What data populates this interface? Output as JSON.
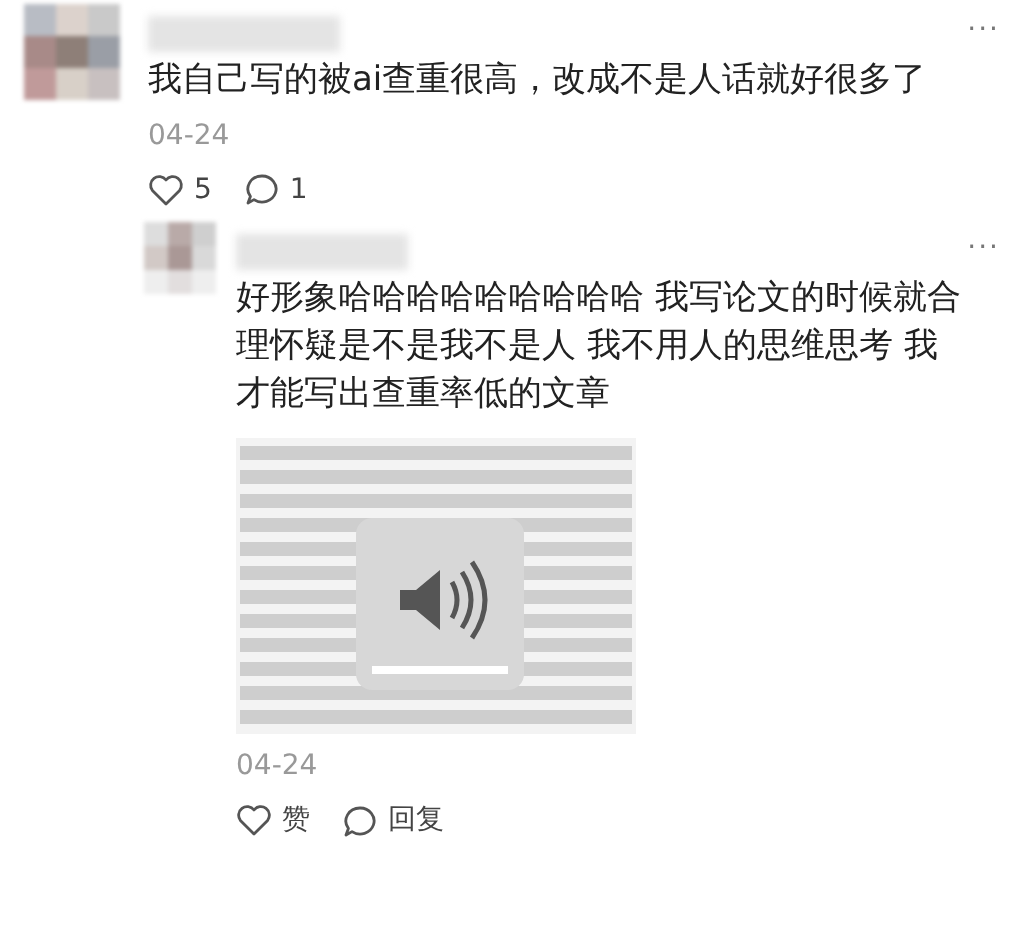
{
  "comment": {
    "text": "我自己写的被ai查重很高，改成不是人话就好很多了",
    "date": "04-24",
    "more": "···",
    "likes": "5",
    "replies": "1"
  },
  "reply": {
    "text": "好形象哈哈哈哈哈哈哈哈哈 我写论文的时候就合理怀疑是不是我不是人 我不用人的思维思考 我才能写出查重率低的文章",
    "date": "04-24",
    "more": "···",
    "like_label": "赞",
    "reply_label": "回复"
  }
}
